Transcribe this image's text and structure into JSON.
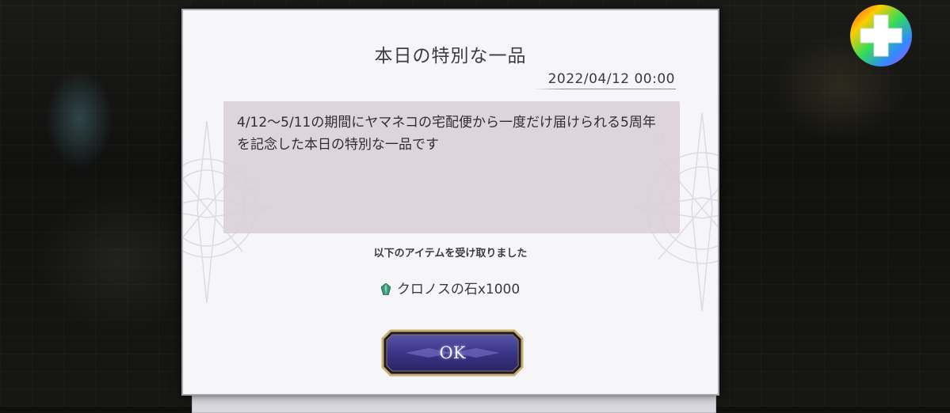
{
  "dialog": {
    "title": "本日の特別な一品",
    "date": "2022/04/12 00:00",
    "message": "4/12〜5/11の期間にヤマネコの宅配便から一度だけ届けられる5周年を記念した本日の特別な一品です",
    "received_label": "以下のアイテムを受け取りました",
    "reward": {
      "icon": "chronos-stone-icon",
      "text": "クロノスの石x1000"
    },
    "ok_label": "OK"
  },
  "overlay": {
    "gamepad_icon": "gamepad-dpad-icon"
  },
  "colors": {
    "dialog_bg": "#f6f5f8",
    "message_bg": "#d9d0d6",
    "ok_button_bg": "#3b3580",
    "ok_button_border": "#c9ad6a"
  }
}
